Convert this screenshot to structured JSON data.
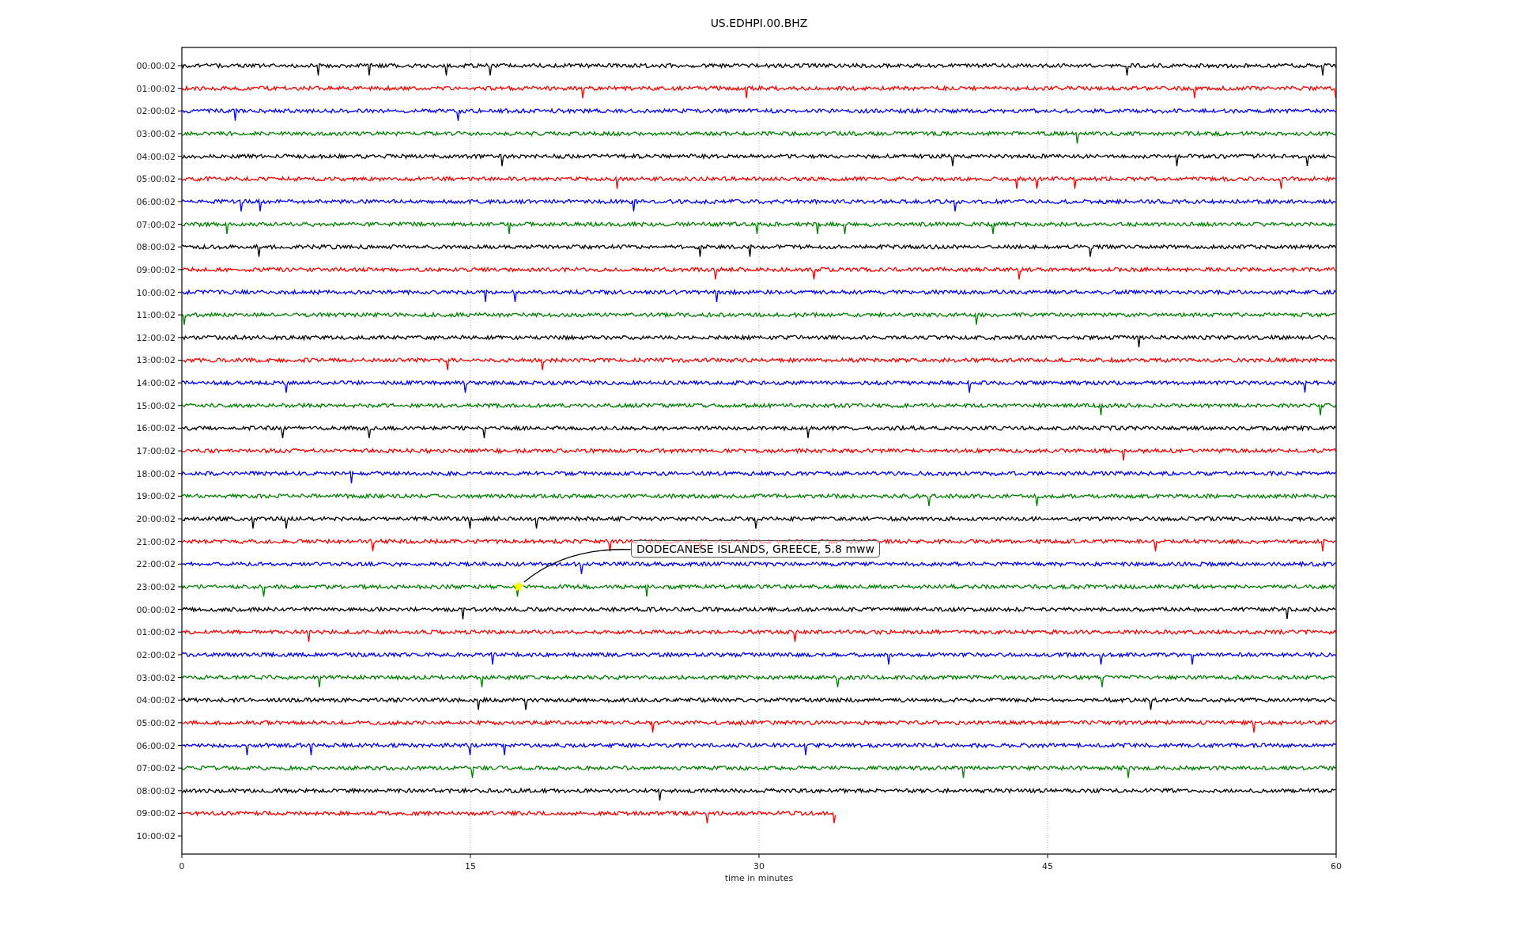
{
  "title": "US.EDHPI.00.BHZ",
  "x_axis": {
    "label": "time in minutes",
    "ticks": [
      "0",
      "15",
      "30",
      "45",
      "60"
    ]
  },
  "traces": [
    {
      "label": "00:00:02",
      "color": "#000000",
      "level": 1
    },
    {
      "label": "01:00:02",
      "color": "#ff0000",
      "level": 1
    },
    {
      "label": "02:00:02",
      "color": "#0000ff",
      "level": 1
    },
    {
      "label": "03:00:02",
      "color": "#008000",
      "level": 1
    },
    {
      "label": "04:00:02",
      "color": "#000000",
      "level": 1
    },
    {
      "label": "05:00:02",
      "color": "#ff0000",
      "level": 1
    },
    {
      "label": "06:00:02",
      "color": "#0000ff",
      "level": 1
    },
    {
      "label": "07:00:02",
      "color": "#008000",
      "level": 1
    },
    {
      "label": "08:00:02",
      "color": "#000000",
      "level": 1
    },
    {
      "label": "09:00:02",
      "color": "#ff0000",
      "level": 1
    },
    {
      "label": "10:00:02",
      "color": "#0000ff",
      "level": 1
    },
    {
      "label": "11:00:02",
      "color": "#008000",
      "level": 1
    },
    {
      "label": "12:00:02",
      "color": "#000000",
      "level": 1
    },
    {
      "label": "13:00:02",
      "color": "#ff0000",
      "level": 1
    },
    {
      "label": "14:00:02",
      "color": "#0000ff",
      "level": 1
    },
    {
      "label": "15:00:02",
      "color": "#008000",
      "level": 1
    },
    {
      "label": "16:00:02",
      "color": "#000000",
      "level": 1
    },
    {
      "label": "17:00:02",
      "color": "#ff0000",
      "level": 1
    },
    {
      "label": "18:00:02",
      "color": "#0000ff",
      "level": 1
    },
    {
      "label": "19:00:02",
      "color": "#008000",
      "level": 1
    },
    {
      "label": "20:00:02",
      "color": "#000000",
      "level": 1
    },
    {
      "label": "21:00:02",
      "color": "#ff0000",
      "level": 1
    },
    {
      "label": "22:00:02",
      "color": "#0000ff",
      "level": 1
    },
    {
      "label": "23:00:02",
      "color": "#008000",
      "level": 1,
      "event": "DODECANESE ISLANDS, GREECE, 5.8 mww"
    },
    {
      "label": "00:00:02",
      "color": "#000000",
      "level": 1
    },
    {
      "label": "01:00:02",
      "color": "#ff0000",
      "level": 1
    },
    {
      "label": "02:00:02",
      "color": "#0000ff",
      "level": 1
    },
    {
      "label": "03:00:02",
      "color": "#008000",
      "level": 1
    },
    {
      "label": "04:00:02",
      "color": "#000000",
      "level": 1
    },
    {
      "label": "05:00:02",
      "color": "#ff0000",
      "level": 1
    },
    {
      "label": "06:00:02",
      "color": "#0000ff",
      "level": 1
    },
    {
      "label": "07:00:02",
      "color": "#008000",
      "level": 1
    },
    {
      "label": "08:00:02",
      "color": "#000000",
      "level": 1
    },
    {
      "label": "09:00:02",
      "color": "#ff0000",
      "level": 0.567
    },
    {
      "label": "10:00:02"
    }
  ]
}
